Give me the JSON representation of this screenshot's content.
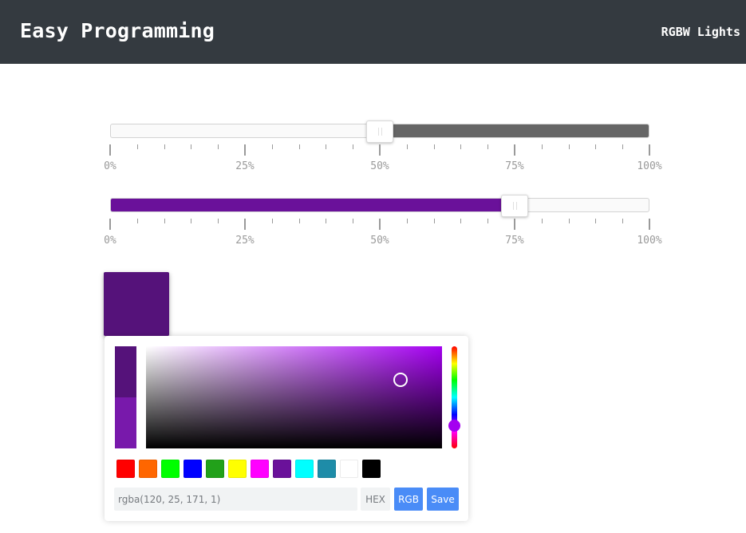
{
  "header": {
    "brand": "Easy Programming",
    "nav_link": "RGBW Lights"
  },
  "sliders": [
    {
      "name": "white",
      "value": 50,
      "fill_side": "right",
      "fill_color": "#666666",
      "labels": [
        "0%",
        "25%",
        "50%",
        "75%",
        "100%"
      ]
    },
    {
      "name": "color",
      "value": 75,
      "fill_side": "left",
      "fill_color": "#6a119a",
      "labels": [
        "0%",
        "25%",
        "50%",
        "75%",
        "100%"
      ]
    }
  ],
  "swatch": {
    "color": "#55127a"
  },
  "picker": {
    "old_color": "#55127a",
    "new_color": "#7819ab",
    "palette_cursor": {
      "saturation": 0.86,
      "value": 0.67
    },
    "hue_thumb_color": "#a400f0",
    "hue_fraction": 0.77,
    "presets": [
      "#ff0000",
      "#ff6600",
      "#00ff00",
      "#0000ff",
      "#22a11a",
      "#ffff00",
      "#ff00ff",
      "#6a119a",
      "#00ffff",
      "#1e8ca8",
      "#ffffff",
      "#000000"
    ],
    "input_value": "rgba(120, 25, 171, 1)",
    "hex_label": "HEX",
    "rgb_label": "RGB",
    "save_label": "Save"
  }
}
